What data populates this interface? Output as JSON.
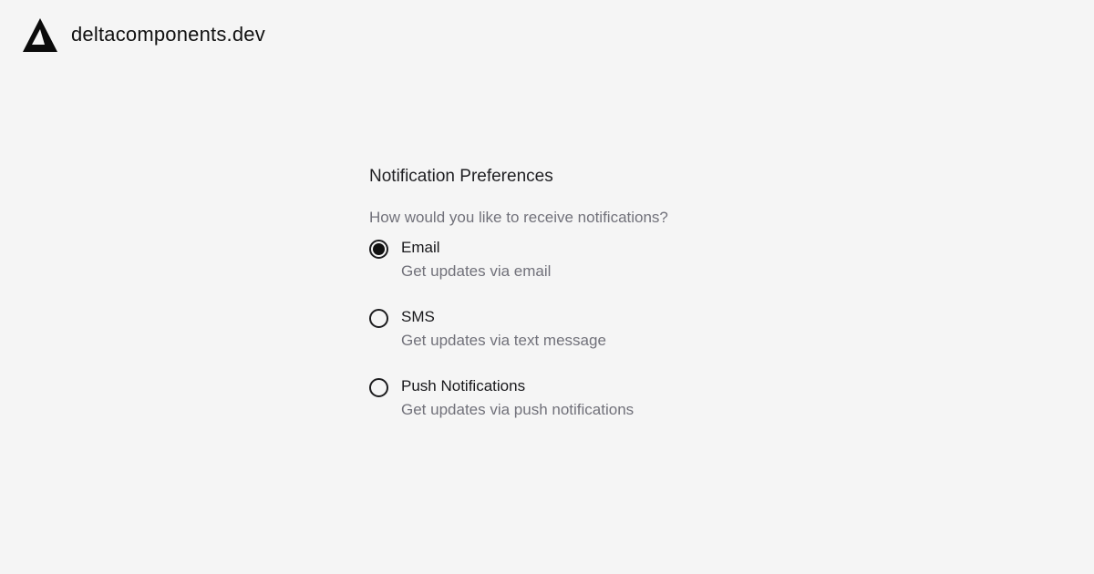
{
  "brand": {
    "name": "deltacomponents.dev",
    "logo_icon": "delta-triangle-icon"
  },
  "preferences": {
    "title": "Notification Preferences",
    "question": "How would you like to receive notifications?",
    "selected": "email",
    "options": [
      {
        "id": "email",
        "label": "Email",
        "description": "Get updates via email",
        "checked": true
      },
      {
        "id": "sms",
        "label": "SMS",
        "description": "Get updates via text message",
        "checked": false
      },
      {
        "id": "push",
        "label": "Push Notifications",
        "description": "Get updates via push notifications",
        "checked": false
      }
    ]
  },
  "colors": {
    "background": "#f5f5f5",
    "text_primary": "#18181b",
    "text_muted": "#71717a",
    "radio_border": "#1c1c1e"
  }
}
